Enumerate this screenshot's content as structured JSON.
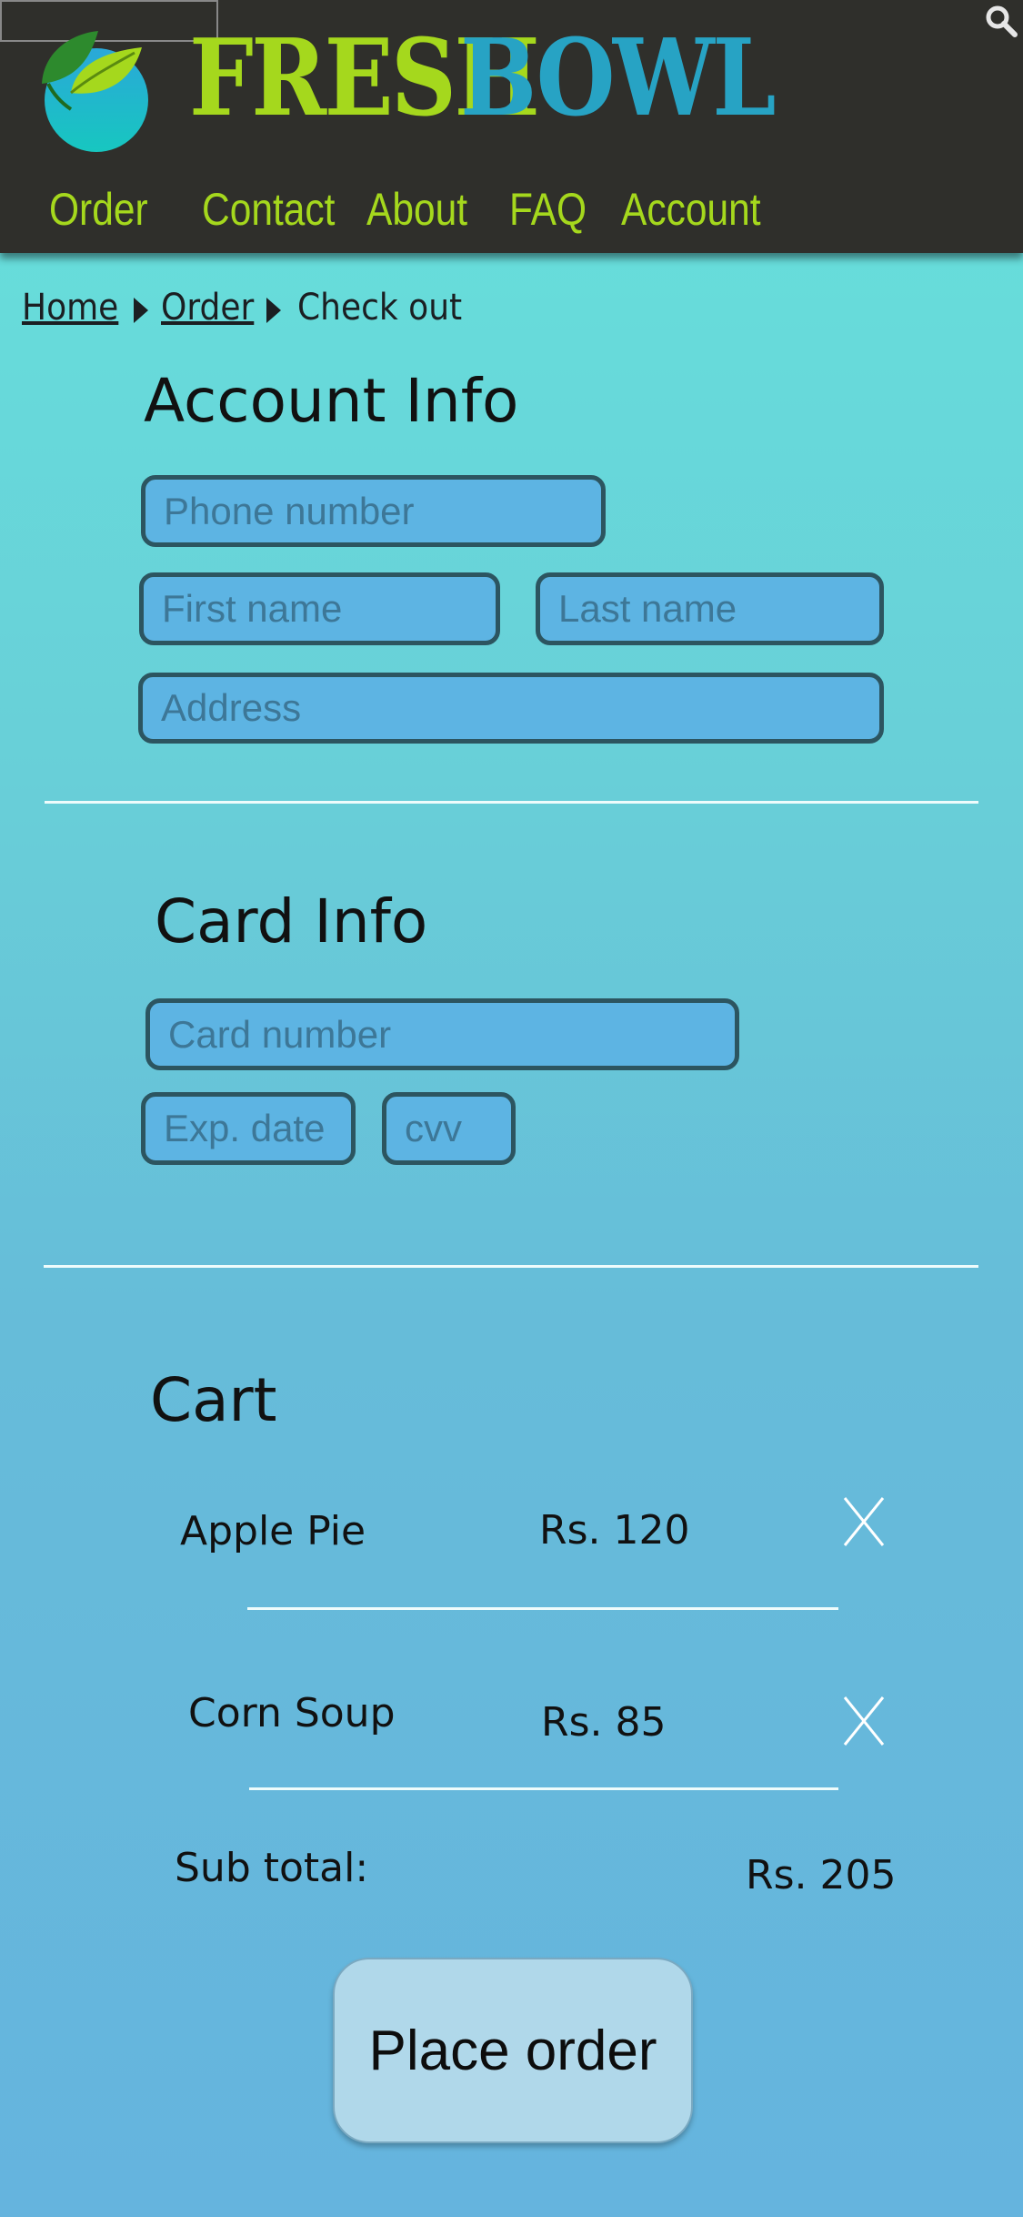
{
  "brand": {
    "word1": "FRESH",
    "word2": "BOWL"
  },
  "nav": {
    "items": [
      "Order",
      "Contact",
      "About",
      "FAQ",
      "Account"
    ]
  },
  "search": {
    "placeholder": "",
    "icon": "search-icon"
  },
  "breadcrumb": {
    "home": "Home",
    "order": "Order",
    "current": "Check out"
  },
  "account_info": {
    "title": "Account Info",
    "phone_placeholder": "Phone number",
    "first_name_placeholder": "First name",
    "last_name_placeholder": "Last name",
    "address_placeholder": "Address"
  },
  "card_info": {
    "title": "Card Info",
    "card_number_placeholder": "Card number",
    "exp_placeholder": "Exp. date",
    "cvv_placeholder": "cvv"
  },
  "cart": {
    "title": "Cart",
    "items": [
      {
        "name": "Apple Pie",
        "price": "Rs. 120"
      },
      {
        "name": "Corn Soup",
        "price": "Rs. 85"
      }
    ],
    "subtotal_label": "Sub total:",
    "subtotal_value": "Rs. 205"
  },
  "place_order_label": "Place order",
  "colors": {
    "brand_green": "#a5d81d",
    "brand_blue": "#27a3c4",
    "header_bg": "#2f2f2b",
    "field_bg": "#5db4e3"
  }
}
